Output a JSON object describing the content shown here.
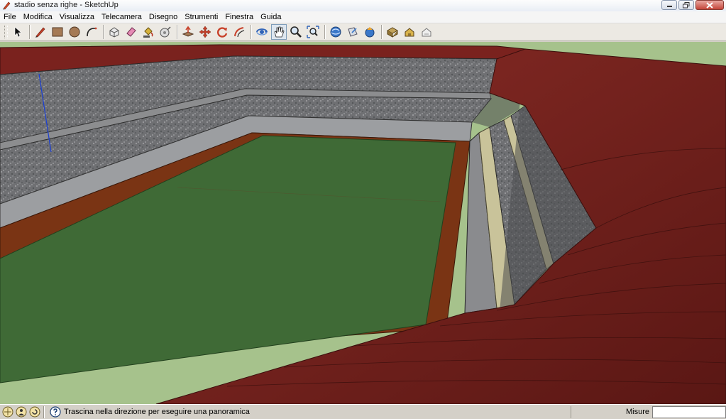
{
  "window": {
    "title": "stadio senza righe - SketchUp"
  },
  "menu": {
    "items": [
      "File",
      "Modifica",
      "Visualizza",
      "Telecamera",
      "Disegno",
      "Strumenti",
      "Finestra",
      "Guida"
    ]
  },
  "toolbar": {
    "tools": [
      "select-icon",
      "pencil-line-icon",
      "rectangle-icon",
      "circle-icon",
      "arc-icon",
      "make-component-icon",
      "eraser-icon",
      "paint-bucket-icon",
      "push-pull-icon",
      "move-icon",
      "rotate-icon",
      "offset-icon",
      "orbit-icon",
      "pan-icon",
      "zoom-icon",
      "zoom-extents-icon",
      "get-models-icon",
      "share-model-icon",
      "components-icon",
      "position-camera-icon",
      "walk-icon",
      "look-around-icon"
    ],
    "selected_tool": "pan-icon"
  },
  "status": {
    "hint": "Trascina nella direzione per eseguire una panoramica",
    "measure_label": "Misure",
    "measure_value": ""
  },
  "colors": {
    "grass": "#3f6a36",
    "track": "#7a3414",
    "roof": "#7a221e",
    "stands": "#6e6f70",
    "ground": "#a6c28c"
  }
}
